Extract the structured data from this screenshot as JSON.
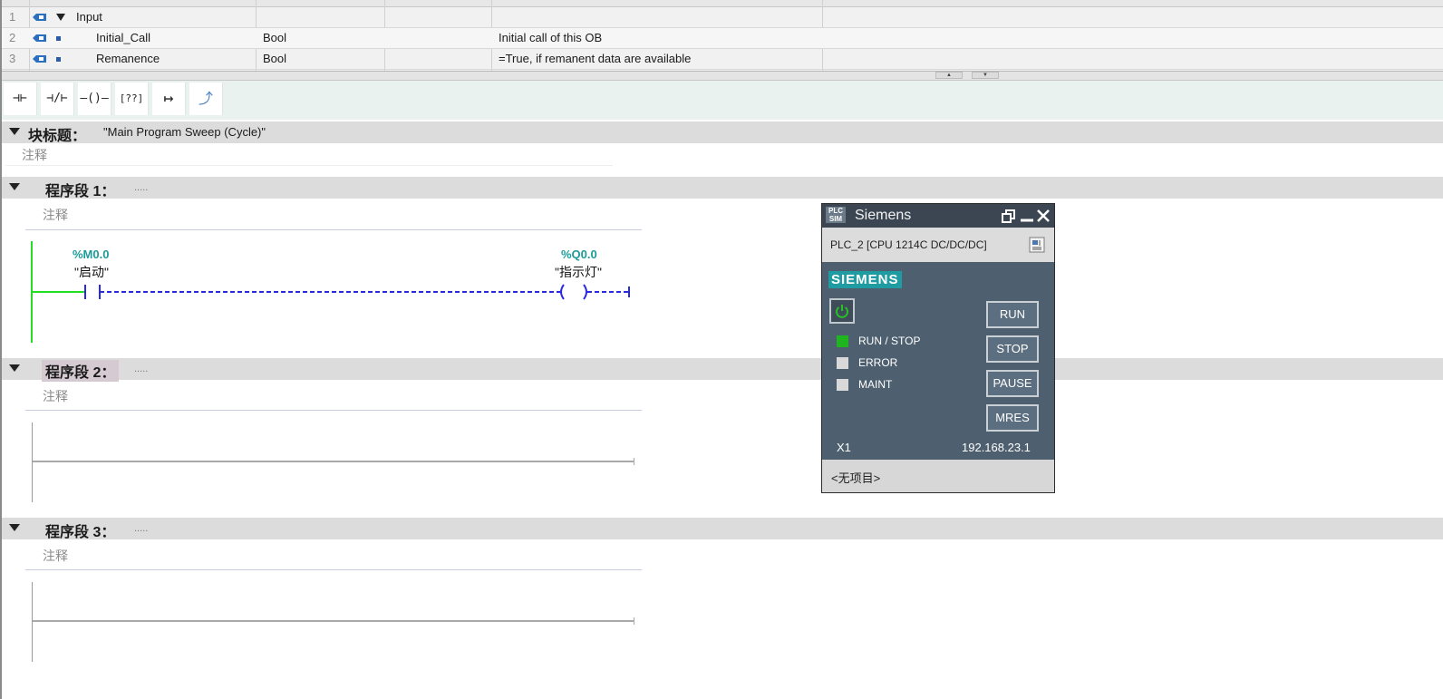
{
  "interface": {
    "rows": [
      {
        "num": "1",
        "name": "Input",
        "type": "",
        "comment": ""
      },
      {
        "num": "2",
        "name": "Initial_Call",
        "type": "Bool",
        "comment": "Initial call of this OB"
      },
      {
        "num": "3",
        "name": "Remanence",
        "type": "Bool",
        "comment": "=True, if remanent data are available"
      }
    ]
  },
  "toolbar": {
    "no_contact": "⊣⊢",
    "nc_contact": "⊣/⊢",
    "coil": "–()–",
    "empty_box": "[??]",
    "open_branch": "↦",
    "close_branch": "⤴"
  },
  "block": {
    "title_label": "块标题：",
    "title_value": "\"Main Program Sweep (Cycle)\"",
    "comment": "注释"
  },
  "networks": [
    {
      "label": "程序段 1：",
      "dots": ".....",
      "comment": "注释",
      "contact": {
        "address": "%M0.0",
        "name": "\"启动\""
      },
      "coil": {
        "address": "%Q0.0",
        "name": "\"指示灯\""
      }
    },
    {
      "label": "程序段 2：",
      "dots": ".....",
      "comment": "注释"
    },
    {
      "label": "程序段 3：",
      "dots": ".....",
      "comment": "注释"
    }
  ],
  "plcsim": {
    "logo": "PLC SIM",
    "title": "Siemens",
    "device": "PLC_2 [CPU 1214C DC/DC/DC]",
    "brand": "SIEMENS",
    "leds": [
      {
        "label": "RUN / STOP",
        "color": "#1fb51f"
      },
      {
        "label": "ERROR",
        "color": "#d9d9d9"
      },
      {
        "label": "MAINT",
        "color": "#d9d9d9"
      }
    ],
    "buttons": {
      "run": "RUN",
      "stop": "STOP",
      "pause": "PAUSE",
      "mres": "MRES"
    },
    "port": "X1",
    "ip": "192.168.23.1",
    "project": "<无项目>"
  }
}
